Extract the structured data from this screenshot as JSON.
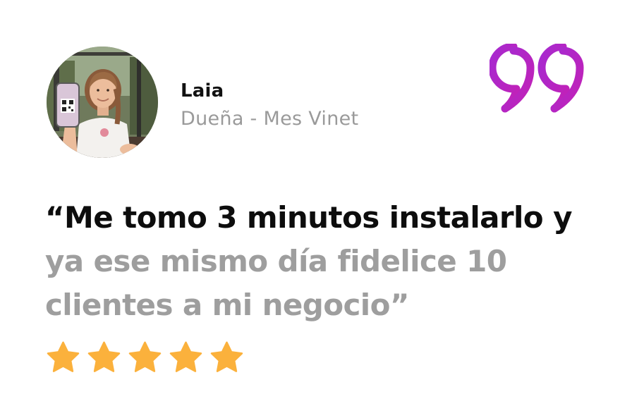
{
  "reviewer": {
    "name": "Laia",
    "role": "Dueña - Mes Vinet",
    "avatar_icon": "person-holding-qr-card-photo"
  },
  "quote_icon": "quote-mark-icon",
  "quote_color": "#b026c8",
  "testimonial": {
    "lines": [
      "“Me tomo 3 minutos instalarlo y",
      "ya ese mismo día fidelice 10",
      "clientes a mi negocio”"
    ]
  },
  "rating": {
    "stars": 5,
    "max": 5,
    "star_color": "#fbb13c"
  }
}
